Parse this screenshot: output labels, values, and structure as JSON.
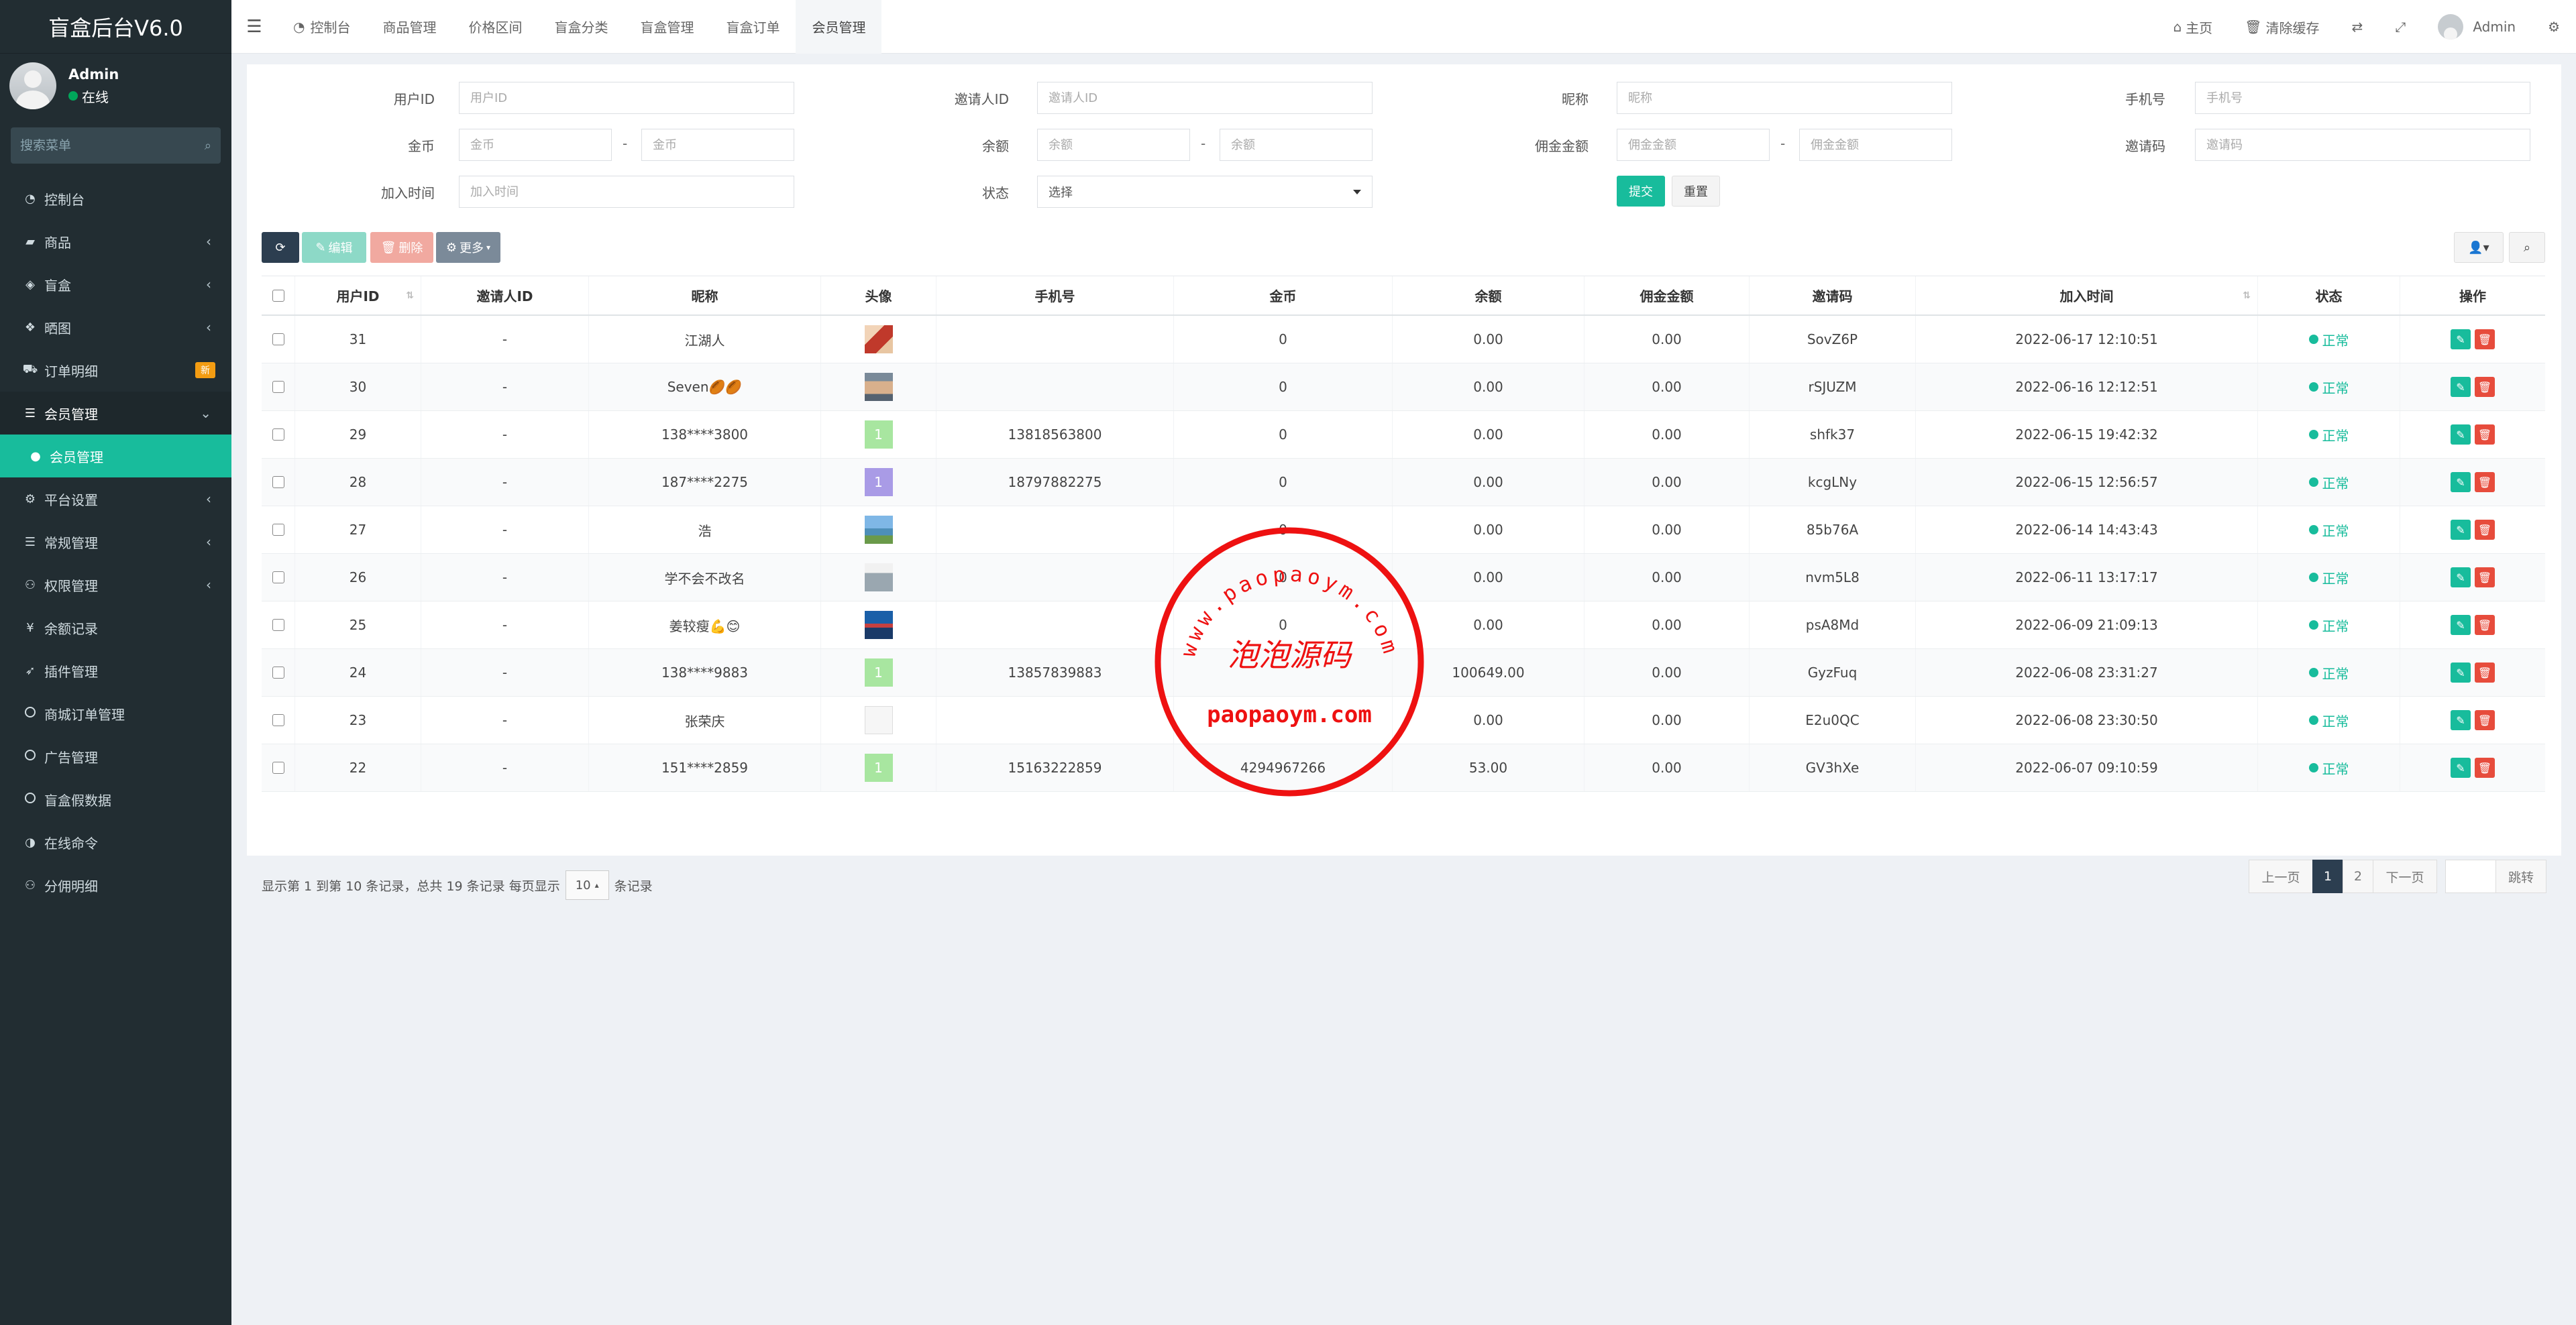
{
  "sidebar": {
    "logo": "盲盒后台V6.0",
    "user": {
      "name": "Admin",
      "status": "在线"
    },
    "search_placeholder": "搜索菜单",
    "items": [
      {
        "label": "控制台",
        "icon": "dashboard-icon",
        "glyph": "◔",
        "chev": ""
      },
      {
        "label": "商品",
        "icon": "shopping-bag-icon",
        "glyph": "▰",
        "chev": "‹"
      },
      {
        "label": "盲盒",
        "icon": "dropbox-icon",
        "glyph": "◈",
        "chev": "‹"
      },
      {
        "label": "晒图",
        "icon": "gift-icon",
        "glyph": "❖",
        "chev": "‹"
      },
      {
        "label": "订单明细",
        "icon": "cart-icon",
        "glyph": "⛟",
        "badge": "新"
      },
      {
        "label": "会员管理",
        "icon": "list-icon",
        "glyph": "☰",
        "chev": "⌄"
      },
      {
        "label": "会员管理",
        "icon": "user-icon",
        "glyph": "●",
        "chev": ""
      },
      {
        "label": "平台设置",
        "icon": "gear-icon",
        "glyph": "⚙",
        "chev": "‹"
      },
      {
        "label": "常规管理",
        "icon": "list-icon",
        "glyph": "☰",
        "chev": "‹"
      },
      {
        "label": "权限管理",
        "icon": "group-icon",
        "glyph": "⚇",
        "chev": "‹"
      },
      {
        "label": "余额记录",
        "icon": "yen-icon",
        "glyph": "¥",
        "chev": ""
      },
      {
        "label": "插件管理",
        "icon": "rocket-icon",
        "glyph": "➶",
        "chev": ""
      },
      {
        "label": "商城订单管理",
        "icon": "circle-icon",
        "glyph": "",
        "chev": ""
      },
      {
        "label": "广告管理",
        "icon": "circle-icon",
        "glyph": "",
        "chev": ""
      },
      {
        "label": "盲盒假数据",
        "icon": "circle-icon",
        "glyph": "",
        "chev": ""
      },
      {
        "label": "在线命令",
        "icon": "adjust-icon",
        "glyph": "◑",
        "chev": ""
      },
      {
        "label": "分佣明细",
        "icon": "group-icon",
        "glyph": "⚇",
        "chev": ""
      }
    ]
  },
  "header": {
    "tabs": [
      {
        "label": "控制台",
        "icon": "dashboard-icon",
        "glyph": "◔"
      },
      {
        "label": "商品管理"
      },
      {
        "label": "价格区间"
      },
      {
        "label": "盲盒分类"
      },
      {
        "label": "盲盒管理"
      },
      {
        "label": "盲盒订单"
      },
      {
        "label": "会员管理"
      }
    ],
    "right": {
      "home": "主页",
      "clear_cache": "清除缓存",
      "admin": "Admin"
    }
  },
  "filters": {
    "user_id": {
      "label": "用户ID",
      "placeholder": "用户ID"
    },
    "inviter_id": {
      "label": "邀请人ID",
      "placeholder": "邀请人ID"
    },
    "nickname": {
      "label": "昵称",
      "placeholder": "昵称"
    },
    "phone": {
      "label": "手机号",
      "placeholder": "手机号"
    },
    "gold": {
      "label": "金币",
      "placeholder": "金币"
    },
    "balance": {
      "label": "余额",
      "placeholder": "余额"
    },
    "commission": {
      "label": "佣金金额",
      "placeholder": "佣金金额"
    },
    "invite_code": {
      "label": "邀请码",
      "placeholder": "邀请码"
    },
    "join_time": {
      "label": "加入时间",
      "placeholder": "加入时间"
    },
    "status": {
      "label": "状态",
      "value": "选择"
    },
    "range_sep": "-",
    "submit": "提交",
    "reset": "重置"
  },
  "toolbar": {
    "edit": "编辑",
    "delete": "删除",
    "more": "更多"
  },
  "table": {
    "columns": [
      "用户ID",
      "邀请人ID",
      "昵称",
      "头像",
      "手机号",
      "金币",
      "余额",
      "佣金金额",
      "邀请码",
      "加入时间",
      "状态",
      "操作"
    ],
    "rows": [
      {
        "id": "31",
        "inviter": "-",
        "nick": "江湖人",
        "avatar": "photo-red",
        "phone": "",
        "gold": "0",
        "balance": "0.00",
        "commission": "0.00",
        "code": "SovZ6P",
        "time": "2022-06-17 12:10:51",
        "status": "正常"
      },
      {
        "id": "30",
        "inviter": "-",
        "nick": "Seven🏉🏉",
        "avatar": "photo-face",
        "phone": "",
        "gold": "0",
        "balance": "0.00",
        "commission": "0.00",
        "code": "rSJUZM",
        "time": "2022-06-16 12:12:51",
        "status": "正常"
      },
      {
        "id": "29",
        "inviter": "-",
        "nick": "138****3800",
        "avatar": "green",
        "phone": "13818563800",
        "gold": "0",
        "balance": "0.00",
        "commission": "0.00",
        "code": "shfk37",
        "time": "2022-06-15 19:42:32",
        "status": "正常"
      },
      {
        "id": "28",
        "inviter": "-",
        "nick": "187****2275",
        "avatar": "purple",
        "phone": "18797882275",
        "gold": "0",
        "balance": "0.00",
        "commission": "0.00",
        "code": "kcgLNy",
        "time": "2022-06-15 12:56:57",
        "status": "正常"
      },
      {
        "id": "27",
        "inviter": "-",
        "nick": "浩",
        "avatar": "photo-scene",
        "phone": "",
        "gold": "0",
        "balance": "0.00",
        "commission": "0.00",
        "code": "85b76A",
        "time": "2022-06-14 14:43:43",
        "status": "正常"
      },
      {
        "id": "26",
        "inviter": "-",
        "nick": "学不会不改名",
        "avatar": "photo-gray",
        "phone": "",
        "gold": "0",
        "balance": "0.00",
        "commission": "0.00",
        "code": "nvm5L8",
        "time": "2022-06-11 13:17:17",
        "status": "正常"
      },
      {
        "id": "25",
        "inviter": "-",
        "nick": "姜较瘦💪😊",
        "avatar": "photo-blue",
        "phone": "",
        "gold": "0",
        "balance": "0.00",
        "commission": "0.00",
        "code": "psA8Md",
        "time": "2022-06-09 21:09:13",
        "status": "正常"
      },
      {
        "id": "24",
        "inviter": "-",
        "nick": "138****9883",
        "avatar": "green",
        "phone": "13857839883",
        "gold": "",
        "balance": "100649.00",
        "commission": "0.00",
        "code": "GyzFuq",
        "time": "2022-06-08 23:31:27",
        "status": "正常"
      },
      {
        "id": "23",
        "inviter": "-",
        "nick": "张荣庆",
        "avatar": "photo-sketch",
        "phone": "",
        "gold": "",
        "balance": "0.00",
        "commission": "0.00",
        "code": "E2u0QC",
        "time": "2022-06-08 23:30:50",
        "status": "正常"
      },
      {
        "id": "22",
        "inviter": "-",
        "nick": "151****2859",
        "avatar": "green",
        "phone": "15163222859",
        "gold": "4294967266",
        "balance": "53.00",
        "commission": "0.00",
        "code": "GV3hXe",
        "time": "2022-06-07 09:10:59",
        "status": "正常"
      }
    ],
    "avatar_letter": "1"
  },
  "pagination": {
    "info_prefix": "显示第 1 到第 10 条记录，总共 19 条记录 每页显示",
    "page_size": "10",
    "info_suffix": "条记录",
    "prev": "上一页",
    "pages": [
      "1",
      "2"
    ],
    "next": "下一页",
    "jump": "跳转"
  },
  "watermark": {
    "arc_text": "www.paopaoym.com",
    "title": "泡泡源码",
    "domain": "paopaoym.com"
  },
  "colors": {
    "sidebar_bg": "#222d32",
    "accent": "#18bc9c",
    "danger": "#e74c3c",
    "warn": "#f39c12",
    "dark_btn": "#2c3e50"
  }
}
